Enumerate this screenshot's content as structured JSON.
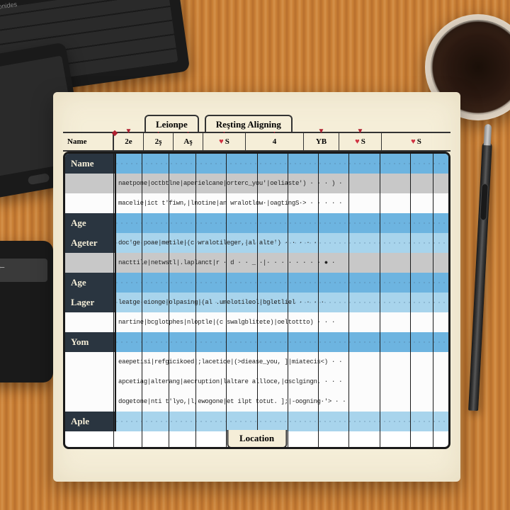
{
  "tabs": {
    "left": "Leionpe",
    "right": "Reşting Aligning"
  },
  "header_cells": [
    "Name",
    "2e",
    "2ş",
    "Aş",
    "S",
    "4",
    "YB",
    "S",
    "S"
  ],
  "side_labels": [
    "Name",
    "",
    "Age",
    "Ageter",
    "",
    "Age",
    "Lager",
    "",
    "Yom",
    "",
    "",
    "",
    "Aple"
  ],
  "bottom_tab": "Location",
  "rows": [
    {
      "style": "blue",
      "side": "Name",
      "text": ""
    },
    {
      "style": "gray",
      "side": "",
      "text": "naetpone|octbtlne|aperielcane|orterc_you'|oeliaste') · · · ) ·"
    },
    {
      "style": "white",
      "side": "",
      "text": "macelie|ict t'fiwn,|lnotine|an wralotlow·|oagtingS·> · · · · ·"
    },
    {
      "style": "blue",
      "side": "Age",
      "text": ""
    },
    {
      "style": "lblue",
      "side": "Ageter",
      "text": "doc'ge|poae|metile|(c wralotileger,|al alte') · · · · ·"
    },
    {
      "style": "gray",
      "side": "",
      "text": "nacttile|netwstl|.laplanct|r · d · · _ ·|· · · · · · ·  · ● ·"
    },
    {
      "style": "blue",
      "side": "Age",
      "text": ""
    },
    {
      "style": "lblue",
      "side": "Lager",
      "text": "leatge|eionge|olpasing|(al .umelotileol|bgletliel · · · ·"
    },
    {
      "style": "white",
      "side": "",
      "text": "nartine|bcglotphes|nloptle|(c swalgblitete)|oeltottto) · · ·"
    },
    {
      "style": "blue",
      "side": "Yom",
      "text": ""
    },
    {
      "style": "white",
      "side": "",
      "text": "eaepetisi|refgicikoed|;lacetice|(>diease_you, ]|miatecis<) · ·"
    },
    {
      "style": "white",
      "side": "",
      "text": "apcetiag|alterang|aecruption|laltare allloce,|osclgingn. · · ·"
    },
    {
      "style": "white",
      "side": "",
      "text": "dogetone|nti t'lyo,|l,ewogone|et ilpt totut. ];|-oogning·'> · ·"
    },
    {
      "style": "lblue",
      "side": "Aple",
      "text": ""
    }
  ],
  "vlines_pct": [
    12.5,
    20,
    27,
    34,
    42,
    50,
    58,
    66,
    74,
    82,
    90,
    96
  ],
  "arrows_pct": [
    14,
    24,
    34,
    44,
    54,
    64,
    76,
    88,
    96
  ]
}
